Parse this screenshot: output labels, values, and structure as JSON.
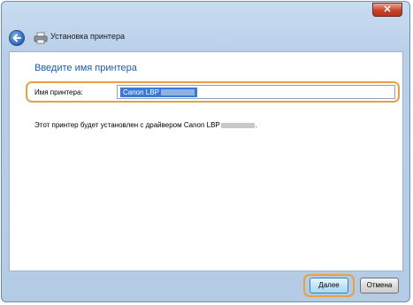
{
  "window": {
    "title": "Установка принтера",
    "close_glyph": "✕"
  },
  "page": {
    "heading": "Введите имя принтера",
    "field_label": "Имя принтера:",
    "field_value": "Canon LBP",
    "info_text_prefix": "Этот принтер будет установлен с драйвером Canon LBP",
    "info_text_suffix": "."
  },
  "footer": {
    "next_label": "Далее",
    "cancel_label": "Отмена"
  },
  "colors": {
    "highlight": "#e7a143",
    "heading": "#1d5aab",
    "selection": "#3a79d6"
  },
  "icons": [
    "close-icon",
    "back-arrow-icon",
    "printer-icon"
  ]
}
